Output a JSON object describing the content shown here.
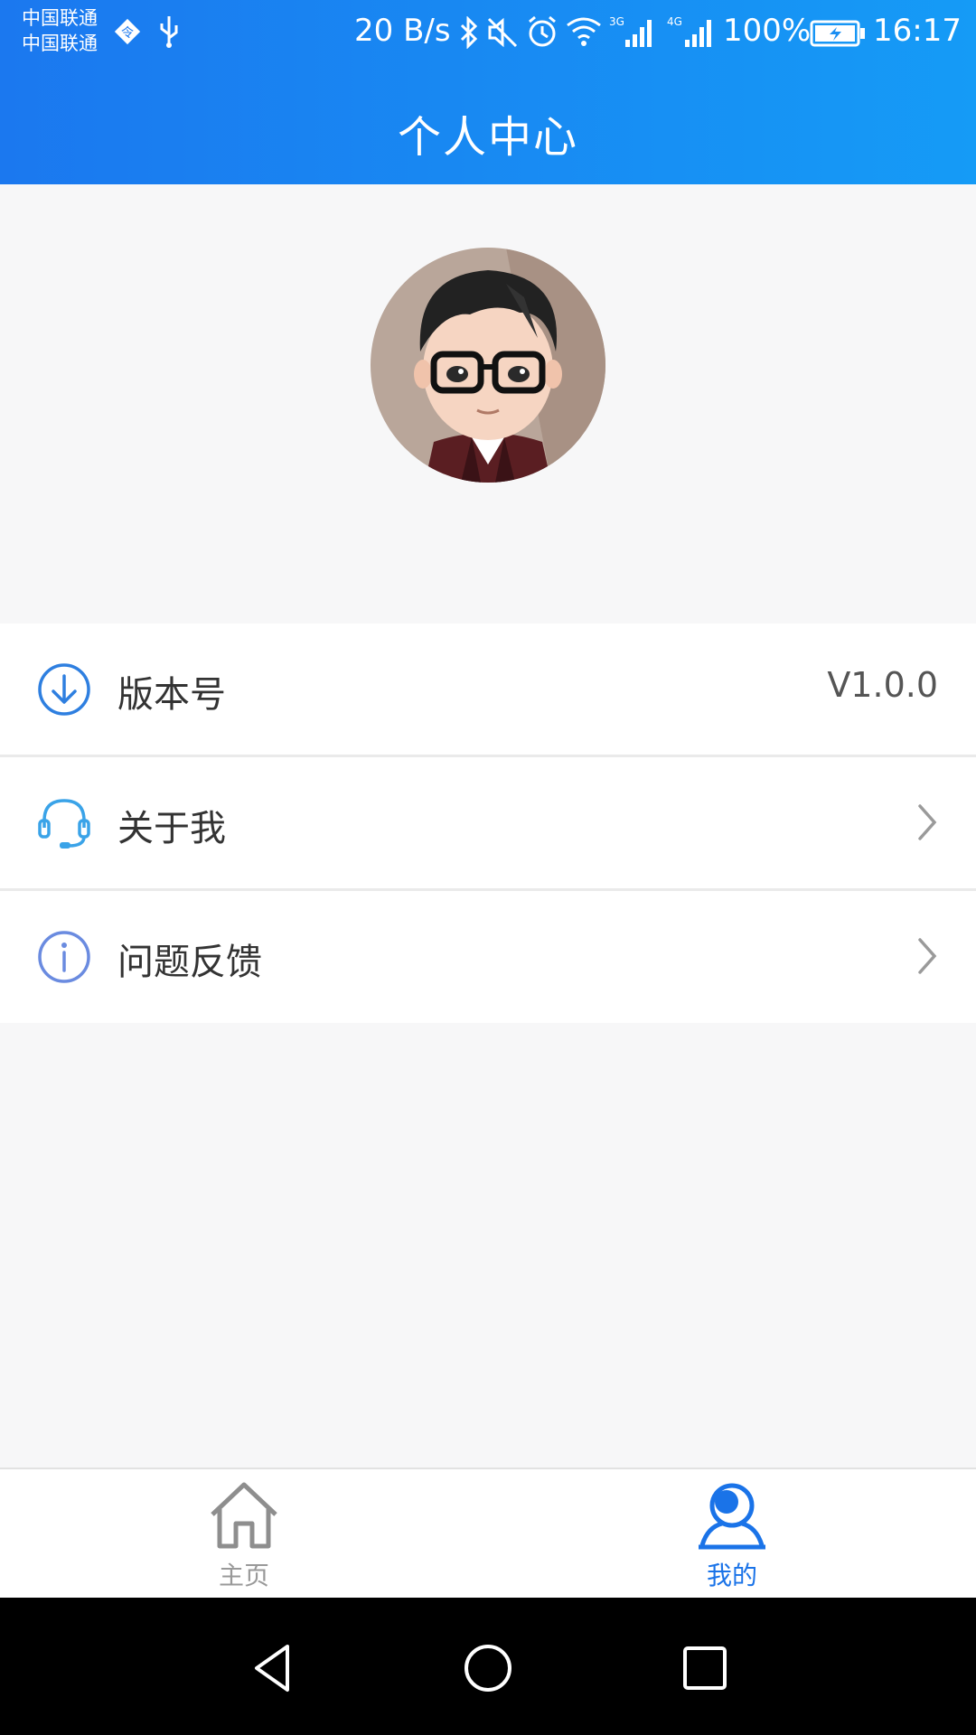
{
  "status_bar": {
    "carrier_1": "中国联通",
    "carrier_2": "中国联通",
    "net_speed": "20 B/s",
    "battery": "100%",
    "time": "16:17",
    "signal_1_type": "3G",
    "signal_2_type": "4G"
  },
  "header": {
    "title": "个人中心"
  },
  "menu": {
    "items": [
      {
        "label": "版本号",
        "value": "V1.0.0",
        "icon": "download-circle-icon"
      },
      {
        "label": "关于我",
        "icon": "headset-icon"
      },
      {
        "label": "问题反馈",
        "icon": "info-circle-icon"
      }
    ]
  },
  "tabbar": {
    "tabs": [
      {
        "label": "主页",
        "icon": "home-icon",
        "active": false
      },
      {
        "label": "我的",
        "icon": "user-icon",
        "active": true
      }
    ]
  },
  "colors": {
    "header_start": "#1b78ef",
    "header_end": "#159bf6",
    "active_tab": "#1a73e8",
    "inactive_tab": "#999999"
  }
}
